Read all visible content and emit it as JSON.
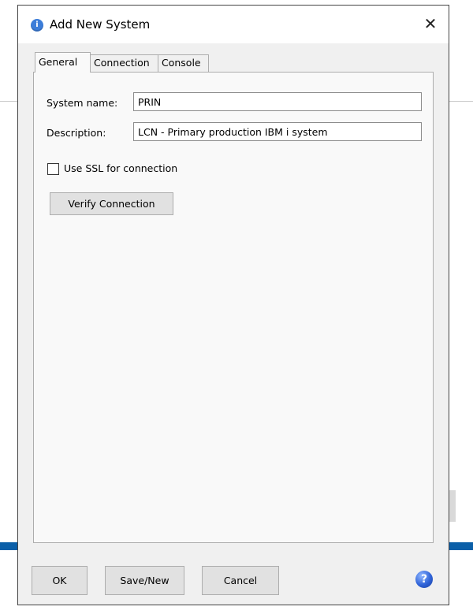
{
  "dialog": {
    "title": "Add New System",
    "close_symbol": "✕",
    "icon": "info-icon"
  },
  "tabs": [
    {
      "label": "General",
      "active": true
    },
    {
      "label": "Connection",
      "active": false
    },
    {
      "label": "Console",
      "active": false
    }
  ],
  "general": {
    "system_name_label": "System name:",
    "system_name_value": "PRIN",
    "description_label": "Description:",
    "description_value": "LCN - Primary production IBM i system",
    "use_ssl_label": "Use SSL for connection",
    "use_ssl_checked": false,
    "verify_button": "Verify Connection"
  },
  "footer": {
    "ok": "OK",
    "save_new": "Save/New",
    "cancel": "Cancel",
    "help_icon": "help-icon",
    "help_symbol": "?"
  },
  "colors": {
    "dialog_bg": "#f0f0f0",
    "panel_bg": "#f9f9f9",
    "help_blue": "#2f63d8",
    "taskbar_blue": "#0b5fa8"
  }
}
